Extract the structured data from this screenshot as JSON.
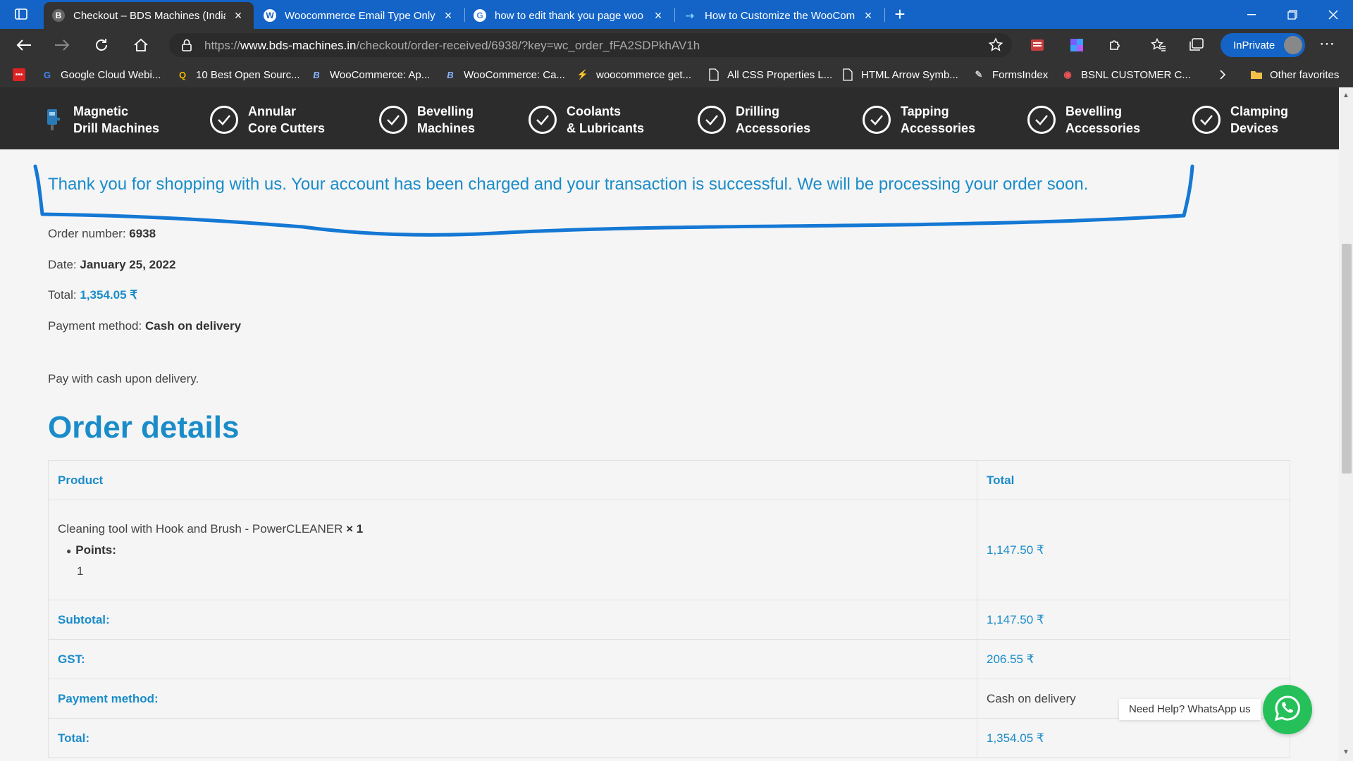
{
  "browser": {
    "tabs": [
      {
        "title": "Checkout – BDS Machines (India",
        "active": true
      },
      {
        "title": "Woocommerce Email Type Only",
        "active": false
      },
      {
        "title": "how to edit thank you page woo",
        "active": false
      },
      {
        "title": "How to Customize the WooCom",
        "active": false
      }
    ],
    "url_prefix": "https://",
    "url_host": "www.bds-machines.in",
    "url_path": "/checkout/order-received/6938/?key=wc_order_fFA2SDPkhAV1h",
    "inprivate_label": "InPrivate",
    "bookmarks": [
      "Google Cloud Webi...",
      "10 Best Open Sourc...",
      "WooCommerce: Ap...",
      "WooCommerce: Ca...",
      "woocommerce get...",
      "All CSS Properties L...",
      "HTML Arrow Symb...",
      "FormsIndex",
      "BSNL CUSTOMER C..."
    ],
    "other_favorites": "Other favorites"
  },
  "site_nav": [
    {
      "line1": "Magnetic",
      "line2": "Drill Machines",
      "icon": "drill-machine-icon"
    },
    {
      "line1": "Annular",
      "line2": "Core Cutters",
      "icon": "checkmark-circle-icon"
    },
    {
      "line1": "Bevelling",
      "line2": "Machines",
      "icon": "checkmark-circle-icon"
    },
    {
      "line1": "Coolants",
      "line2": "& Lubricants",
      "icon": "checkmark-circle-icon"
    },
    {
      "line1": "Drilling",
      "line2": "Accessories",
      "icon": "checkmark-circle-icon"
    },
    {
      "line1": "Tapping",
      "line2": "Accessories",
      "icon": "checkmark-circle-icon"
    },
    {
      "line1": "Bevelling",
      "line2": "Accessories",
      "icon": "checkmark-circle-icon"
    },
    {
      "line1": "Clamping",
      "line2": "Devices",
      "icon": "checkmark-circle-icon"
    }
  ],
  "order": {
    "thank_you": "Thank you for shopping with us. Your account has been charged and your transaction is successful. We will be processing your order soon.",
    "number_label": "Order number: ",
    "number": "6938",
    "date_label": "Date: ",
    "date": "January 25, 2022",
    "total_label": "Total: ",
    "total": "1,354.05 ₹",
    "payment_label": "Payment method: ",
    "payment": "Cash on delivery",
    "pay_note": "Pay with cash upon delivery.",
    "details_title": "Order details",
    "table": {
      "col_product": "Product",
      "col_total": "Total",
      "item_name": "Cleaning tool with Hook and Brush - PowerCLEANER",
      "item_qty": "× 1",
      "item_meta_label": "Points:",
      "item_meta_value": "1",
      "item_total": "1,147.50 ₹",
      "rows": [
        {
          "label": "Subtotal:",
          "value": "1,147.50 ₹",
          "style": "val"
        },
        {
          "label": "GST:",
          "value": "206.55 ₹",
          "style": "val"
        },
        {
          "label": "Payment method:",
          "value": "Cash on delivery",
          "style": "plain"
        },
        {
          "label": "Total:",
          "value": "1,354.05 ₹",
          "style": "val"
        }
      ]
    }
  },
  "whatsapp": {
    "label": "Need Help? WhatsApp us"
  },
  "colors": {
    "accent": "#1a8cc9",
    "nav_bg": "#2c2c2c",
    "whatsapp": "#25c05a",
    "edge_blue": "#1464c7"
  }
}
